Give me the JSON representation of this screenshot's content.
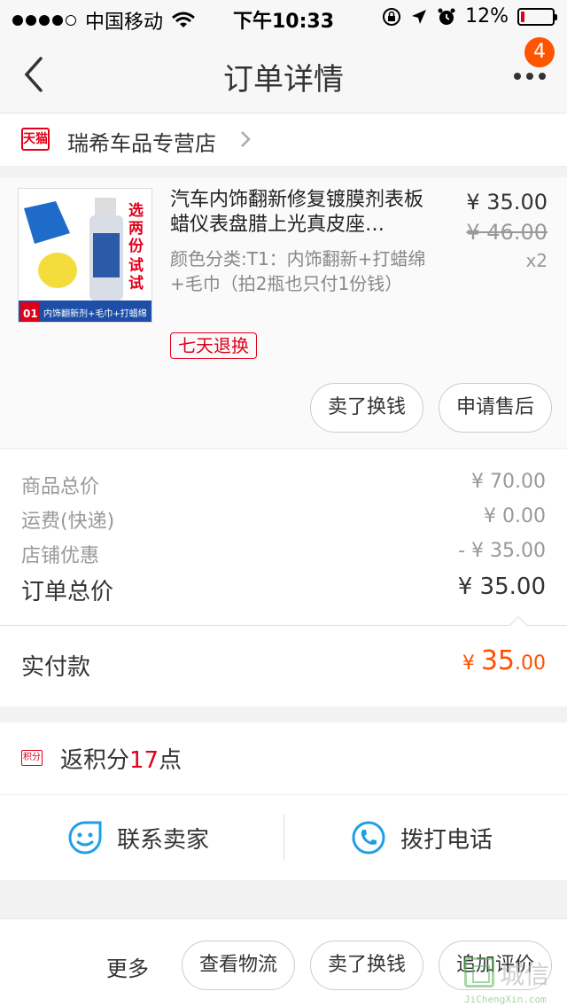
{
  "status_bar": {
    "carrier": "中国移动",
    "time": "下午10:33",
    "battery": "12%",
    "battery_level": 0.12
  },
  "nav": {
    "title": "订单详情",
    "badge": "4",
    "icons": {
      "back": "chevron-left-icon",
      "more": "more-dots-icon"
    }
  },
  "shop": {
    "logo_text": "天猫",
    "name": "瑞希车品专营店"
  },
  "product": {
    "title": "汽车内饰翻新修复镀膜剂表板蜡仪表盘腊上光真皮座…",
    "spec": "颜色分类:T1：内饰翻新+打蜡绵+毛巾（拍2瓶也只付1份钱）",
    "tag": "七天退换",
    "price": "¥ 35.00",
    "original_price": "¥ 46.00",
    "quantity": "x2",
    "image_text": {
      "promo": [
        "选",
        "两",
        "份",
        "试",
        "试"
      ],
      "bottom_no": "01",
      "bottom_text": "内饰翻新剂+毛巾+打蜡绵"
    },
    "buttons": {
      "sell": "卖了换钱",
      "after_sale": "申请售后"
    }
  },
  "totals": {
    "rows": [
      {
        "label": "商品总价",
        "value": "¥ 70.00"
      },
      {
        "label": "运费(快递)",
        "value": "¥ 0.00"
      },
      {
        "label": "店铺优惠",
        "value": "- ¥ 35.00"
      }
    ],
    "order_total_label": "订单总价",
    "order_total_value": "¥ 35.00"
  },
  "paid": {
    "label": "实付款",
    "currency": "¥ ",
    "integer": "35",
    "decimal": ".00",
    "color": "#ff5000"
  },
  "points": {
    "icon_text": "积分",
    "prefix": "返积分",
    "number": "17",
    "suffix": "点"
  },
  "contact": {
    "seller": "联系卖家",
    "phone": "拨打电话",
    "accent": "#1e9fe8"
  },
  "bottom": {
    "more": "更多",
    "buttons": [
      "查看物流",
      "卖了换钱",
      "追加评价"
    ]
  },
  "watermark": {
    "text": "城信",
    "url": "JiChengXin.com"
  },
  "colors": {
    "brand_red": "#e0001a",
    "orange": "#ff5500"
  }
}
